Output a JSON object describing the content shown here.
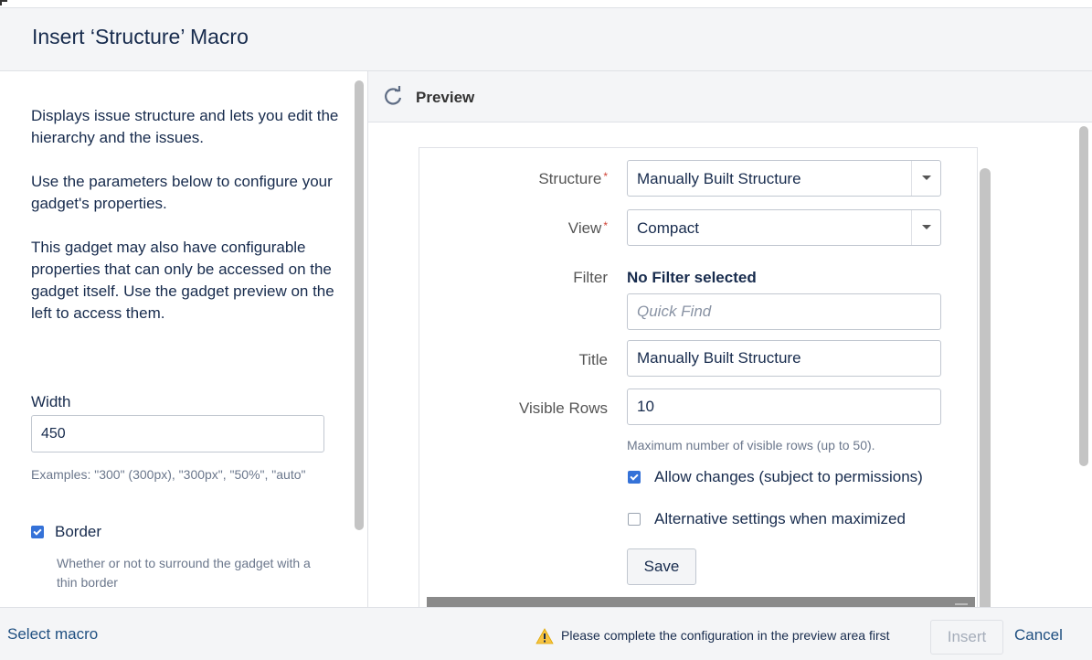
{
  "dialog": {
    "title": "Insert ‘Structure’ Macro"
  },
  "left_panel": {
    "description": [
      "Displays issue structure and lets you edit the hierarchy and the issues.",
      "Use the parameters below to configure your gadget's properties.",
      "This gadget may also have configurable properties that can only be accessed on the gadget itself. Use the gadget preview on the left to access them."
    ],
    "width_label": "Width",
    "width_value": "450",
    "width_examples": "Examples: \"300\" (300px), \"300px\", \"50%\", \"auto\"",
    "border_label": "Border",
    "border_checked": true,
    "border_help": "Whether or not to surround the gadget with a thin border"
  },
  "preview": {
    "label": "Preview",
    "gadget": {
      "structure_label": "Structure",
      "structure_value": "Manually Built Structure",
      "view_label": "View",
      "view_value": "Compact",
      "required_marker": "*",
      "filter_label": "Filter",
      "filter_value": "No Filter selected",
      "quick_find_placeholder": "Quick Find",
      "title_label": "Title",
      "title_value": "Manually Built Structure",
      "visible_rows_label": "Visible Rows",
      "visible_rows_value": "10",
      "visible_rows_hint": "Maximum number of visible rows (up to 50).",
      "allow_changes_label": "Allow changes (subject to permissions)",
      "allow_changes_checked": true,
      "alt_settings_label": "Alternative settings when maximized",
      "alt_settings_checked": false,
      "save_label": "Save"
    }
  },
  "footer": {
    "select_macro": "Select macro",
    "warning": "Please complete the configuration in the preview area first",
    "insert_label": "Insert",
    "cancel_label": "Cancel"
  },
  "colors": {
    "accent": "#3572d8",
    "link": "#205081",
    "required": "#d04437",
    "warning": "#f6c342"
  }
}
